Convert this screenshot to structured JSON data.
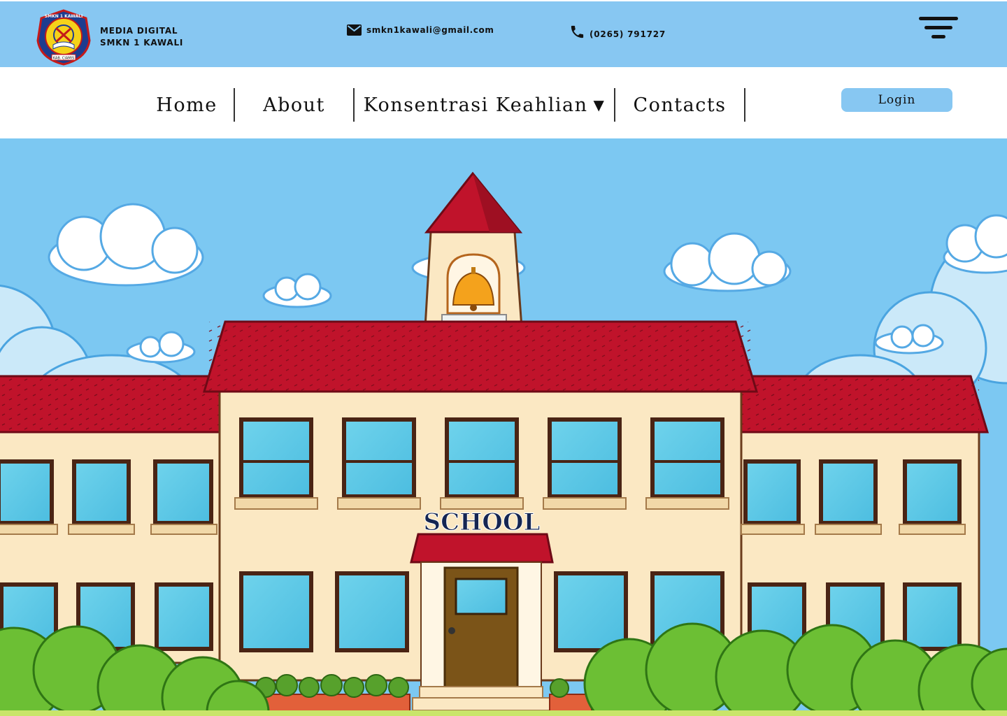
{
  "header": {
    "brand_line1": "MEDIA DIGITAL",
    "brand_line2": "SMKN 1 KAWALI",
    "email": "smkn1kawali@gmail.com",
    "phone": "(0265) 791727",
    "logo_top_text": "SMKN 1 KAWALI",
    "logo_bottom_text": "KAB. CIAMIS"
  },
  "nav": {
    "items": [
      {
        "label": "Home"
      },
      {
        "label": "About"
      },
      {
        "label": "Konsentrasi Keahlian",
        "caret": "▼"
      },
      {
        "label": "Contacts"
      }
    ],
    "login_label": "Login"
  },
  "hero": {
    "sign_text": "SCHOOL"
  },
  "colors": {
    "topbar": "#87c7f2",
    "sky": "#7cc8f2",
    "roof": "#c0132b",
    "wall": "#fbe8c3",
    "login_button": "#87c7f2"
  },
  "icons": [
    "envelope-icon",
    "phone-icon",
    "hamburger-menu-icon",
    "caret-down-icon",
    "school-logo",
    "bell-icon"
  ]
}
